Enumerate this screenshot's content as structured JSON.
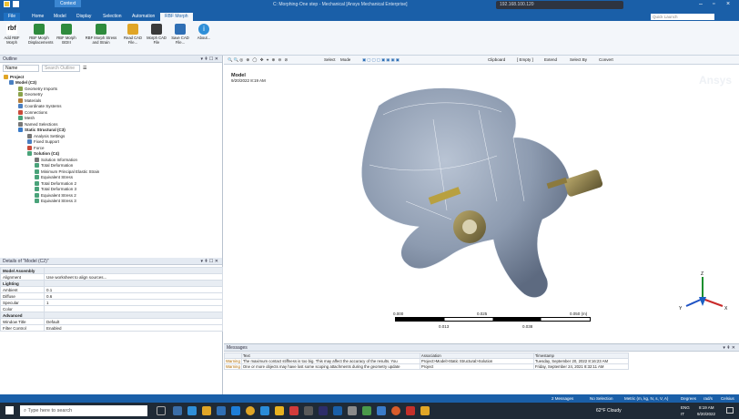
{
  "window": {
    "title": "C: Morphing-One step - Mechanical [Ansys Mechanical Enterprise]",
    "context_tab": "Context",
    "remote_label": "192.168.100.120"
  },
  "ribbon_tabs": [
    "File",
    "Home",
    "Model",
    "Display",
    "Selection",
    "Automation",
    "RBF Morph"
  ],
  "quick_launch_placeholder": "Quick Launch",
  "ribbon_buttons": [
    {
      "label": "Add RBF Morph",
      "color": "#1a1a1a"
    },
    {
      "label": "RBF Morph Displacements",
      "color": "#2e8b3d"
    },
    {
      "label": "RBF Morph BGIII",
      "color": "#2e8b3d"
    },
    {
      "label": "RBF Morph Stress and Strain",
      "color": "#2e8b3d"
    },
    {
      "label": "Read CAD File...",
      "color": "#e0a526"
    },
    {
      "label": "Morph CAD File",
      "color": "#3a3a3a"
    },
    {
      "label": "Save CAD File...",
      "color": "#2f6fb5"
    },
    {
      "label": "About...",
      "color": "#2f8fd8"
    }
  ],
  "outline": {
    "title": "Outline",
    "name_label": "Name",
    "search_placeholder": "Search Outline",
    "items": [
      {
        "label": "Project",
        "bold": true,
        "color": "#e0a526"
      },
      {
        "label": "Model (C3)",
        "bold": true,
        "color": "#4a7fc1"
      },
      {
        "label": "Geometry Imports",
        "bold": false,
        "color": "#8aa34b"
      },
      {
        "label": "Geometry",
        "bold": false,
        "color": "#8aa34b"
      },
      {
        "label": "Materials",
        "bold": false,
        "color": "#b57d3a"
      },
      {
        "label": "Coordinate Systems",
        "bold": false,
        "color": "#4a7fc1"
      },
      {
        "label": "Connections",
        "bold": false,
        "color": "#c94a3a"
      },
      {
        "label": "Mesh",
        "bold": false,
        "color": "#4aa37a"
      },
      {
        "label": "Named Selections",
        "bold": false,
        "color": "#777777"
      },
      {
        "label": "Static Structural (C3)",
        "bold": true,
        "color": "#3a7bc8"
      },
      {
        "label": "Analysis Settings",
        "bold": false,
        "color": "#777777"
      },
      {
        "label": "Fixed Support",
        "bold": false,
        "color": "#4a7fc1"
      },
      {
        "label": "Force",
        "bold": false,
        "color": "#c94a3a"
      },
      {
        "label": "Solution (C4)",
        "bold": true,
        "color": "#4aa37a"
      },
      {
        "label": "Solution Information",
        "bold": false,
        "color": "#777777"
      },
      {
        "label": "Total Deformation",
        "bold": false,
        "color": "#4aa37a"
      },
      {
        "label": "Minimum Principal Elastic Strain",
        "bold": false,
        "color": "#4aa37a"
      },
      {
        "label": "Equivalent Stress",
        "bold": false,
        "color": "#4aa37a"
      },
      {
        "label": "Total Deformation 2",
        "bold": false,
        "color": "#4aa37a"
      },
      {
        "label": "Total Deformation 3",
        "bold": false,
        "color": "#4aa37a"
      },
      {
        "label": "Equivalent Stress 2",
        "bold": false,
        "color": "#4aa37a"
      },
      {
        "label": "Equivalent Stress 3",
        "bold": false,
        "color": "#4aa37a"
      }
    ]
  },
  "details": {
    "title": "Details of \"Model (C2)\"",
    "rows": [
      {
        "group": true,
        "key": "Model Assembly",
        "value": ""
      },
      {
        "group": false,
        "key": "Alignment",
        "value": "Use worksheet to align sources..."
      },
      {
        "group": true,
        "key": "Lighting",
        "value": ""
      },
      {
        "group": false,
        "key": "Ambient",
        "value": "0.1"
      },
      {
        "group": false,
        "key": "Diffuse",
        "value": "0.6"
      },
      {
        "group": false,
        "key": "Specular",
        "value": "1"
      },
      {
        "group": false,
        "key": "Color",
        "value": ""
      },
      {
        "group": true,
        "key": "Advanced",
        "value": ""
      },
      {
        "group": false,
        "key": "Window Title",
        "value": "Default"
      },
      {
        "group": false,
        "key": "Filter Control",
        "value": "Enabled"
      }
    ]
  },
  "graphics_toolbar": {
    "select": "Select",
    "mode": "Mode",
    "clipboard": "Clipboard",
    "empty": "[ Empty ]",
    "extend": "Extend",
    "select_by": "Select By",
    "convert": "Convert"
  },
  "viewport": {
    "model_label": "Model",
    "timestamp": "9/20/2022 8:19 AM",
    "watermark": "Ansys",
    "scale_top": [
      "0.000",
      "0.025",
      "0.050 (m)"
    ],
    "scale_bottom": [
      "0.013",
      "0.038"
    ],
    "axes": {
      "x": "X",
      "y": "Y",
      "z": "Z"
    }
  },
  "messages": {
    "title": "Messages",
    "columns": [
      "Text",
      "Association",
      "Timestamp"
    ],
    "rows": [
      {
        "type": "Warning",
        "text": "The maximum contact stiffness is too big. This may affect the accuracy of the results. You",
        "assoc": "Project>Model>Static Structural>Solution",
        "time": "Tuesday, September 20, 2022 8:16:23 AM"
      },
      {
        "type": "Warning",
        "text": "One or more objects may have lost some scoping attachments during the geometry update",
        "assoc": "Project",
        "time": "Friday, September 24, 2021 8:32:11 AM"
      }
    ]
  },
  "status": {
    "messages": "2 Messages",
    "selection": "No Selection",
    "units": "Metric (m, kg, N, s, V, A)",
    "angle": "Degrees",
    "rad": "rad/s",
    "temp": "Celsius"
  },
  "taskbar": {
    "search_placeholder": "Type here to search",
    "weather": "62°F  Cloudy",
    "lang": "ENG",
    "lang2": "IT",
    "time": "8:19 AM",
    "date": "9/20/2022"
  }
}
